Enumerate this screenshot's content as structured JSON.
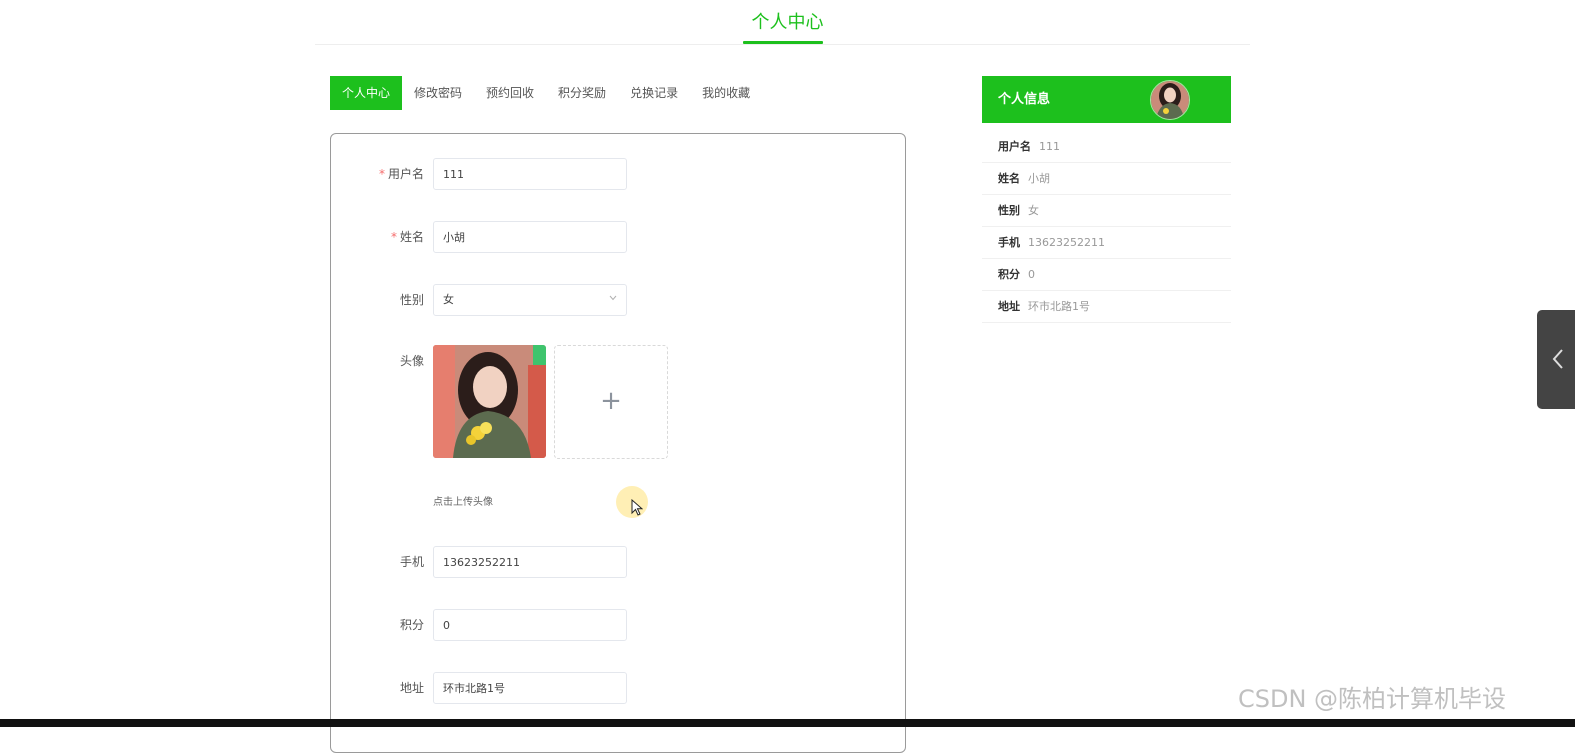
{
  "header": {
    "title": "个人中心"
  },
  "tabs": [
    {
      "label": "个人中心"
    },
    {
      "label": "修改密码"
    },
    {
      "label": "预约回收"
    },
    {
      "label": "积分奖励"
    },
    {
      "label": "兑换记录"
    },
    {
      "label": "我的收藏"
    }
  ],
  "form": {
    "username": {
      "label": "用户名",
      "required": true,
      "value": "111"
    },
    "name": {
      "label": "姓名",
      "required": true,
      "value": "小胡"
    },
    "gender": {
      "label": "性别",
      "value": "女"
    },
    "avatar": {
      "label": "头像",
      "upload_icon": "+",
      "hint": "点击上传头像"
    },
    "phone": {
      "label": "手机",
      "value": "13623252211"
    },
    "points": {
      "label": "积分",
      "value": "0"
    },
    "address": {
      "label": "地址",
      "value": "环市北路1号"
    }
  },
  "sidebar": {
    "title": "个人信息",
    "items": [
      {
        "key": "用户名",
        "value": "111"
      },
      {
        "key": "姓名",
        "value": "小胡"
      },
      {
        "key": "性别",
        "value": "女"
      },
      {
        "key": "手机",
        "value": "13623252211"
      },
      {
        "key": "积分",
        "value": "0"
      },
      {
        "key": "地址",
        "value": "环市北路1号"
      }
    ]
  },
  "watermark": "CSDN @陈柏计算机毕设",
  "colors": {
    "accent": "#1dc01d",
    "required": "#f56c6c"
  }
}
